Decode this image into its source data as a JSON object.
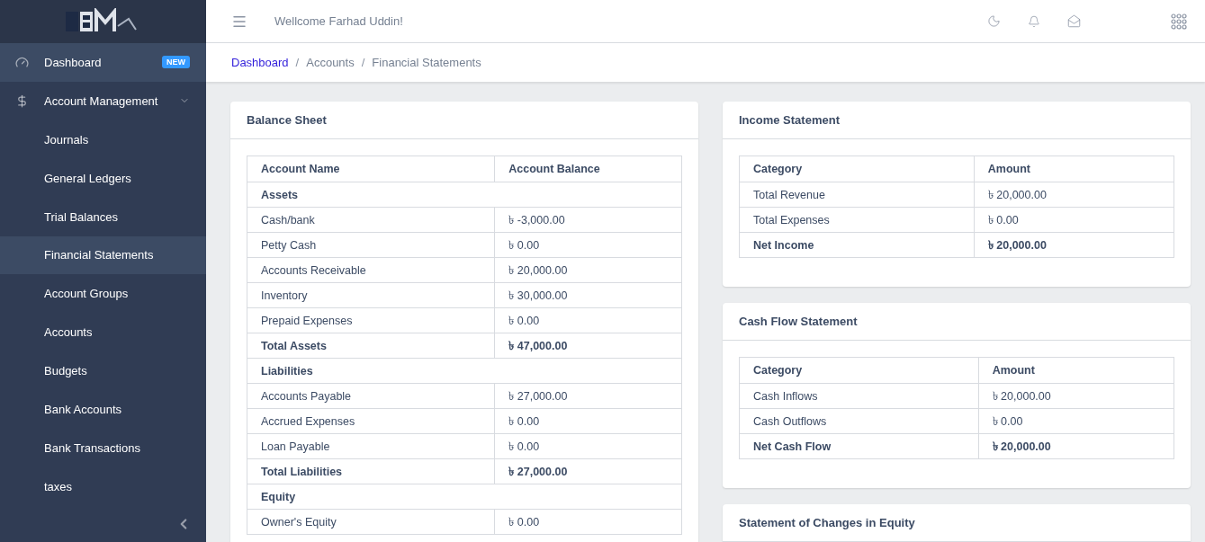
{
  "sidebar": {
    "items": [
      {
        "label": "Dashboard",
        "badge": "NEW",
        "selected": true
      },
      {
        "label": "Account Management",
        "selected": false,
        "expanded": true,
        "children": [
          {
            "label": "Journals",
            "selected": false
          },
          {
            "label": "General Ledgers",
            "selected": false
          },
          {
            "label": "Trial Balances",
            "selected": false
          },
          {
            "label": "Financial Statements",
            "selected": true
          },
          {
            "label": "Account Groups",
            "selected": false
          },
          {
            "label": "Accounts",
            "selected": false
          },
          {
            "label": "Budgets",
            "selected": false
          },
          {
            "label": "Bank Accounts",
            "selected": false
          },
          {
            "label": "Bank Transactions",
            "selected": false
          },
          {
            "label": "taxes",
            "selected": false
          }
        ]
      }
    ]
  },
  "header": {
    "welcome": "Wellcome Farhad Uddin!"
  },
  "breadcrumb": {
    "separator": "/",
    "items": [
      "Dashboard",
      "Accounts",
      "Financial Statements"
    ]
  },
  "balance_sheet": {
    "title": "Balance Sheet",
    "columns": [
      "Account Name",
      "Account Balance"
    ],
    "rows": [
      {
        "kind": "section",
        "name": "Assets"
      },
      {
        "kind": "item",
        "name": "Cash/bank",
        "value": "৳ -3,000.00"
      },
      {
        "kind": "item",
        "name": "Petty Cash",
        "value": "৳ 0.00"
      },
      {
        "kind": "item",
        "name": "Accounts Receivable",
        "value": "৳ 20,000.00"
      },
      {
        "kind": "item",
        "name": "Inventory",
        "value": "৳ 30,000.00"
      },
      {
        "kind": "item",
        "name": "Prepaid Expenses",
        "value": "৳ 0.00"
      },
      {
        "kind": "total",
        "name": "Total Assets",
        "value": "৳ 47,000.00"
      },
      {
        "kind": "section",
        "name": "Liabilities"
      },
      {
        "kind": "item",
        "name": "Accounts Payable",
        "value": "৳ 27,000.00"
      },
      {
        "kind": "item",
        "name": "Accrued Expenses",
        "value": "৳ 0.00"
      },
      {
        "kind": "item",
        "name": "Loan Payable",
        "value": "৳ 0.00"
      },
      {
        "kind": "total",
        "name": "Total Liabilities",
        "value": "৳ 27,000.00"
      },
      {
        "kind": "section",
        "name": "Equity"
      },
      {
        "kind": "item",
        "name": "Owner's Equity",
        "value": "৳ 0.00"
      }
    ]
  },
  "income_statement": {
    "title": "Income Statement",
    "columns": [
      "Category",
      "Amount"
    ],
    "rows": [
      {
        "kind": "item",
        "name": "Total Revenue",
        "value": "৳ 20,000.00"
      },
      {
        "kind": "item",
        "name": "Total Expenses",
        "value": "৳ 0.00"
      },
      {
        "kind": "total",
        "name": "Net Income",
        "value": "৳ 20,000.00"
      }
    ]
  },
  "cash_flow_statement": {
    "title": "Cash Flow Statement",
    "columns": [
      "Category",
      "Amount"
    ],
    "rows": [
      {
        "kind": "item",
        "name": "Cash Inflows",
        "value": "৳ 20,000.00"
      },
      {
        "kind": "item",
        "name": "Cash Outflows",
        "value": "৳ 0.00"
      },
      {
        "kind": "total",
        "name": "Net Cash Flow",
        "value": "৳ 20,000.00"
      }
    ]
  },
  "equity_statement": {
    "title": "Statement of Changes in Equity"
  }
}
